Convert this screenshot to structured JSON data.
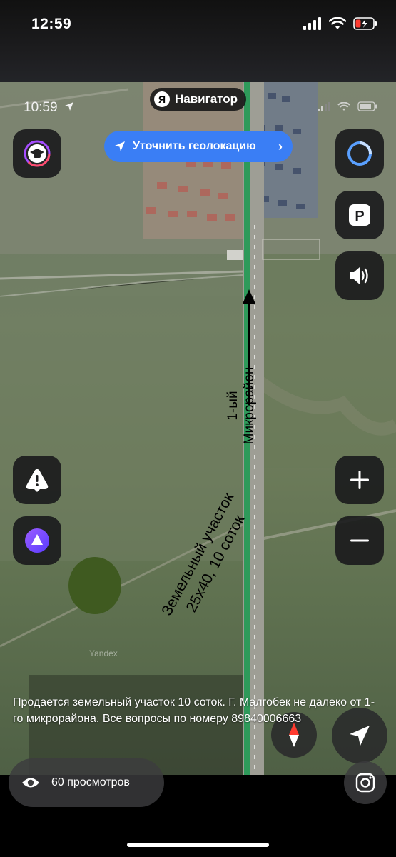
{
  "outer_status": {
    "time": "12:59"
  },
  "inner_status": {
    "time": "10:59"
  },
  "app": {
    "logo_letter": "Я",
    "name": "Навигатор"
  },
  "geolocation_button": {
    "label": "Уточнить геолокацию"
  },
  "map_labels": {
    "arrow_label_line1": "1-ый",
    "arrow_label_line2": "Микрорайон",
    "plot_label_line1": "Земельный участок",
    "plot_label_line2": "25x40, 10 соток",
    "watermark": "Yandex"
  },
  "caption": "Продается земельный участок 10 соток. Г. Малгобек не далеко от 1-го микрорайона. Все вопросы по номеру 89840006663",
  "views": {
    "count_text": "60 просмотров"
  },
  "icons": [
    "academy-icon",
    "alice-ring-icon",
    "parking-icon",
    "sound-icon",
    "warning-icon",
    "alice-icon",
    "zoom-in-icon",
    "zoom-out-icon",
    "compass-icon",
    "navigate-icon",
    "eye-icon",
    "instagram-icon"
  ],
  "colors": {
    "accent_blue": "#3a7ef5",
    "route_green": "#2e9a5a",
    "plot_marker": "#3f5a20"
  }
}
